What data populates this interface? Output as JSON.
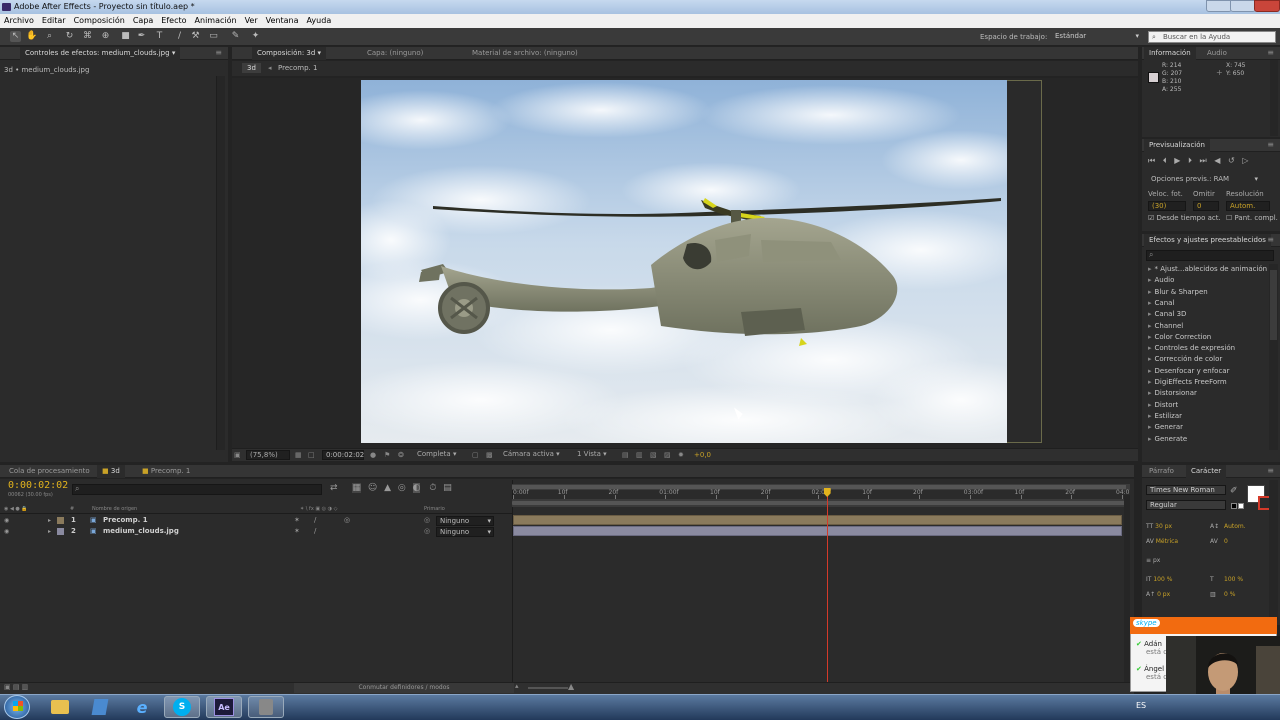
{
  "window": {
    "title": "Adobe After Effects - Proyecto sin título.aep *"
  },
  "menu": [
    "Archivo",
    "Editar",
    "Composición",
    "Capa",
    "Efecto",
    "Animación",
    "Ver",
    "Ventana",
    "Ayuda"
  ],
  "toolbar": {
    "workspace_label": "Espacio de trabajo:",
    "workspace_value": "Estándar",
    "search_placeholder": "Buscar en la Ayuda"
  },
  "left_panel": {
    "tab": "Controles de efectos: medium_clouds.jpg",
    "breadcrumb": "3d • medium_clouds.jpg"
  },
  "comp_panel": {
    "tabs": [
      "Composición: 3d",
      "Capa: (ninguno)",
      "Material de archivo: (ninguno)"
    ],
    "nav": [
      "3d",
      "Precomp. 1"
    ],
    "footer": {
      "zoom": "(75,8%)",
      "timecode": "0:00:02:02",
      "resolution": "Completa",
      "camera": "Cámara activa",
      "views": "1 Vista",
      "offset": "+0,0"
    }
  },
  "info_panel": {
    "tabs": [
      "Información",
      "Audio"
    ],
    "r": "R: 214",
    "g": "G: 207",
    "b": "B: 210",
    "a": "A: 255",
    "x": "X: 745",
    "y": "Y: 650",
    "swatch_color": "#d6cfd2"
  },
  "preview_panel": {
    "title": "Previsualización",
    "options": "Opciones previs.: RAM",
    "fps_label": "Veloc. fot.",
    "skip_label": "Omitir",
    "res_label": "Resolución",
    "fps_value": "(30)",
    "skip_value": "0",
    "res_value": "Autom.",
    "from_current": "Desde tiempo act.",
    "fullscreen": "Pant. compl."
  },
  "effects_panel": {
    "title": "Efectos y ajustes preestablecidos",
    "items": [
      "* Ajust...ablecidos de animación",
      "Audio",
      "Blur & Sharpen",
      "Canal",
      "Canal 3D",
      "Channel",
      "Color Correction",
      "Controles de expresión",
      "Corrección de color",
      "Desenfocar y enfocar",
      "DigiEffects FreeForm",
      "Distorsionar",
      "Distort",
      "Estilizar",
      "Generar",
      "Generate"
    ]
  },
  "bottom_tabs": [
    "Cola de procesamiento",
    "3d",
    "Precomp. 1"
  ],
  "timeline": {
    "timecode": "0:00:02:02",
    "frame_info": "00062 (30.00 fps)",
    "columns": {
      "source_name": "Nombre de origen",
      "parent": "Primario"
    },
    "layers": [
      {
        "num": "1",
        "name": "Precomp. 1",
        "parent": "Ninguno"
      },
      {
        "num": "2",
        "name": "medium_clouds.jpg",
        "parent": "Ninguno"
      }
    ],
    "ruler": [
      "0:00f",
      "10f",
      "20f",
      "01:00f",
      "10f",
      "20f",
      "02:00f",
      "10f",
      "20f",
      "03:00f",
      "10f",
      "20f",
      "04:0"
    ],
    "footer_toggle": "Conmutar definidores / modos",
    "playhead_fraction": 0.515
  },
  "char_panel": {
    "tabs": [
      "Párrafo",
      "Carácter"
    ],
    "font": "Times New Roman",
    "style": "Regular",
    "size": "30 px",
    "leading": "Autom.",
    "tracking_metric": "Métrica",
    "tracking": "0",
    "stroke": "px",
    "vscale": "100 %",
    "hscale": "100 %",
    "baseline": "0 px",
    "tsume": "0 %"
  },
  "skype": {
    "title": "skype",
    "contacts": [
      {
        "name": "Adán",
        "status": "está c"
      },
      {
        "name": "Ángel",
        "status": "está c"
      }
    ]
  },
  "taskbar": {
    "lang": "ES",
    "apps": [
      "windows-start",
      "explorer",
      "windows-media",
      "internet-explorer",
      "skype",
      "after-effects",
      "media-player"
    ],
    "ae_label": "Ae",
    "skype_label": "S"
  }
}
